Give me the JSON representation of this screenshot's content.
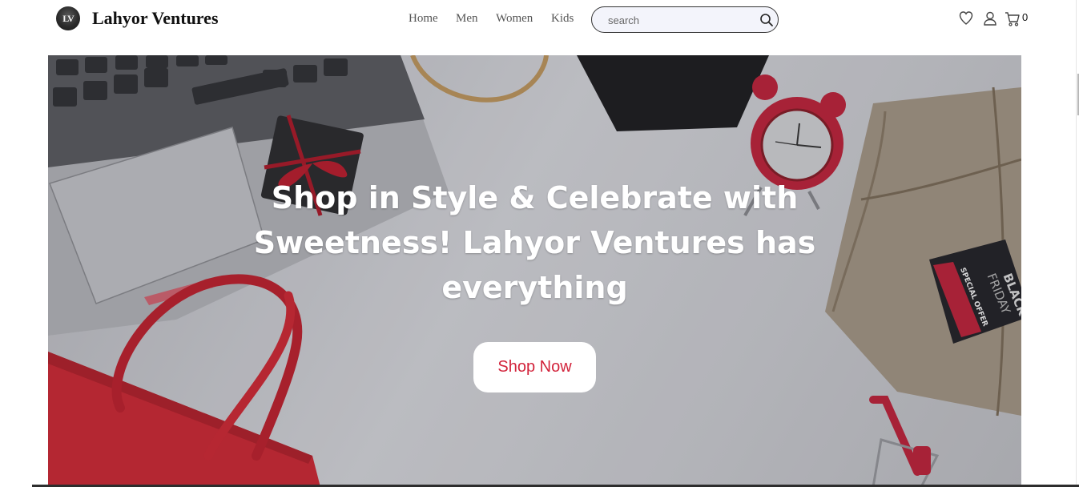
{
  "brand": {
    "name": "Lahyor Ventures",
    "logo_text": "LV"
  },
  "nav": {
    "home": "Home",
    "men": "Men",
    "women": "Women",
    "kids": "Kids"
  },
  "search": {
    "placeholder": "search",
    "icon": "search-icon"
  },
  "header_icons": {
    "wishlist": "heart-icon",
    "account": "user-icon",
    "cart": "cart-icon"
  },
  "cart": {
    "count": "0"
  },
  "hero": {
    "headline": "Shop in Style & Celebrate with Sweetness! Lahyor Ventures has everything",
    "cta_label": "Shop Now",
    "tag_line1": "BLACK",
    "tag_line2": "FRIDAY",
    "tag_line3": "SPECIAL OFFER"
  },
  "colors": {
    "accent": "#d2233b",
    "text": "#111111",
    "hero_text": "#ffffff"
  }
}
